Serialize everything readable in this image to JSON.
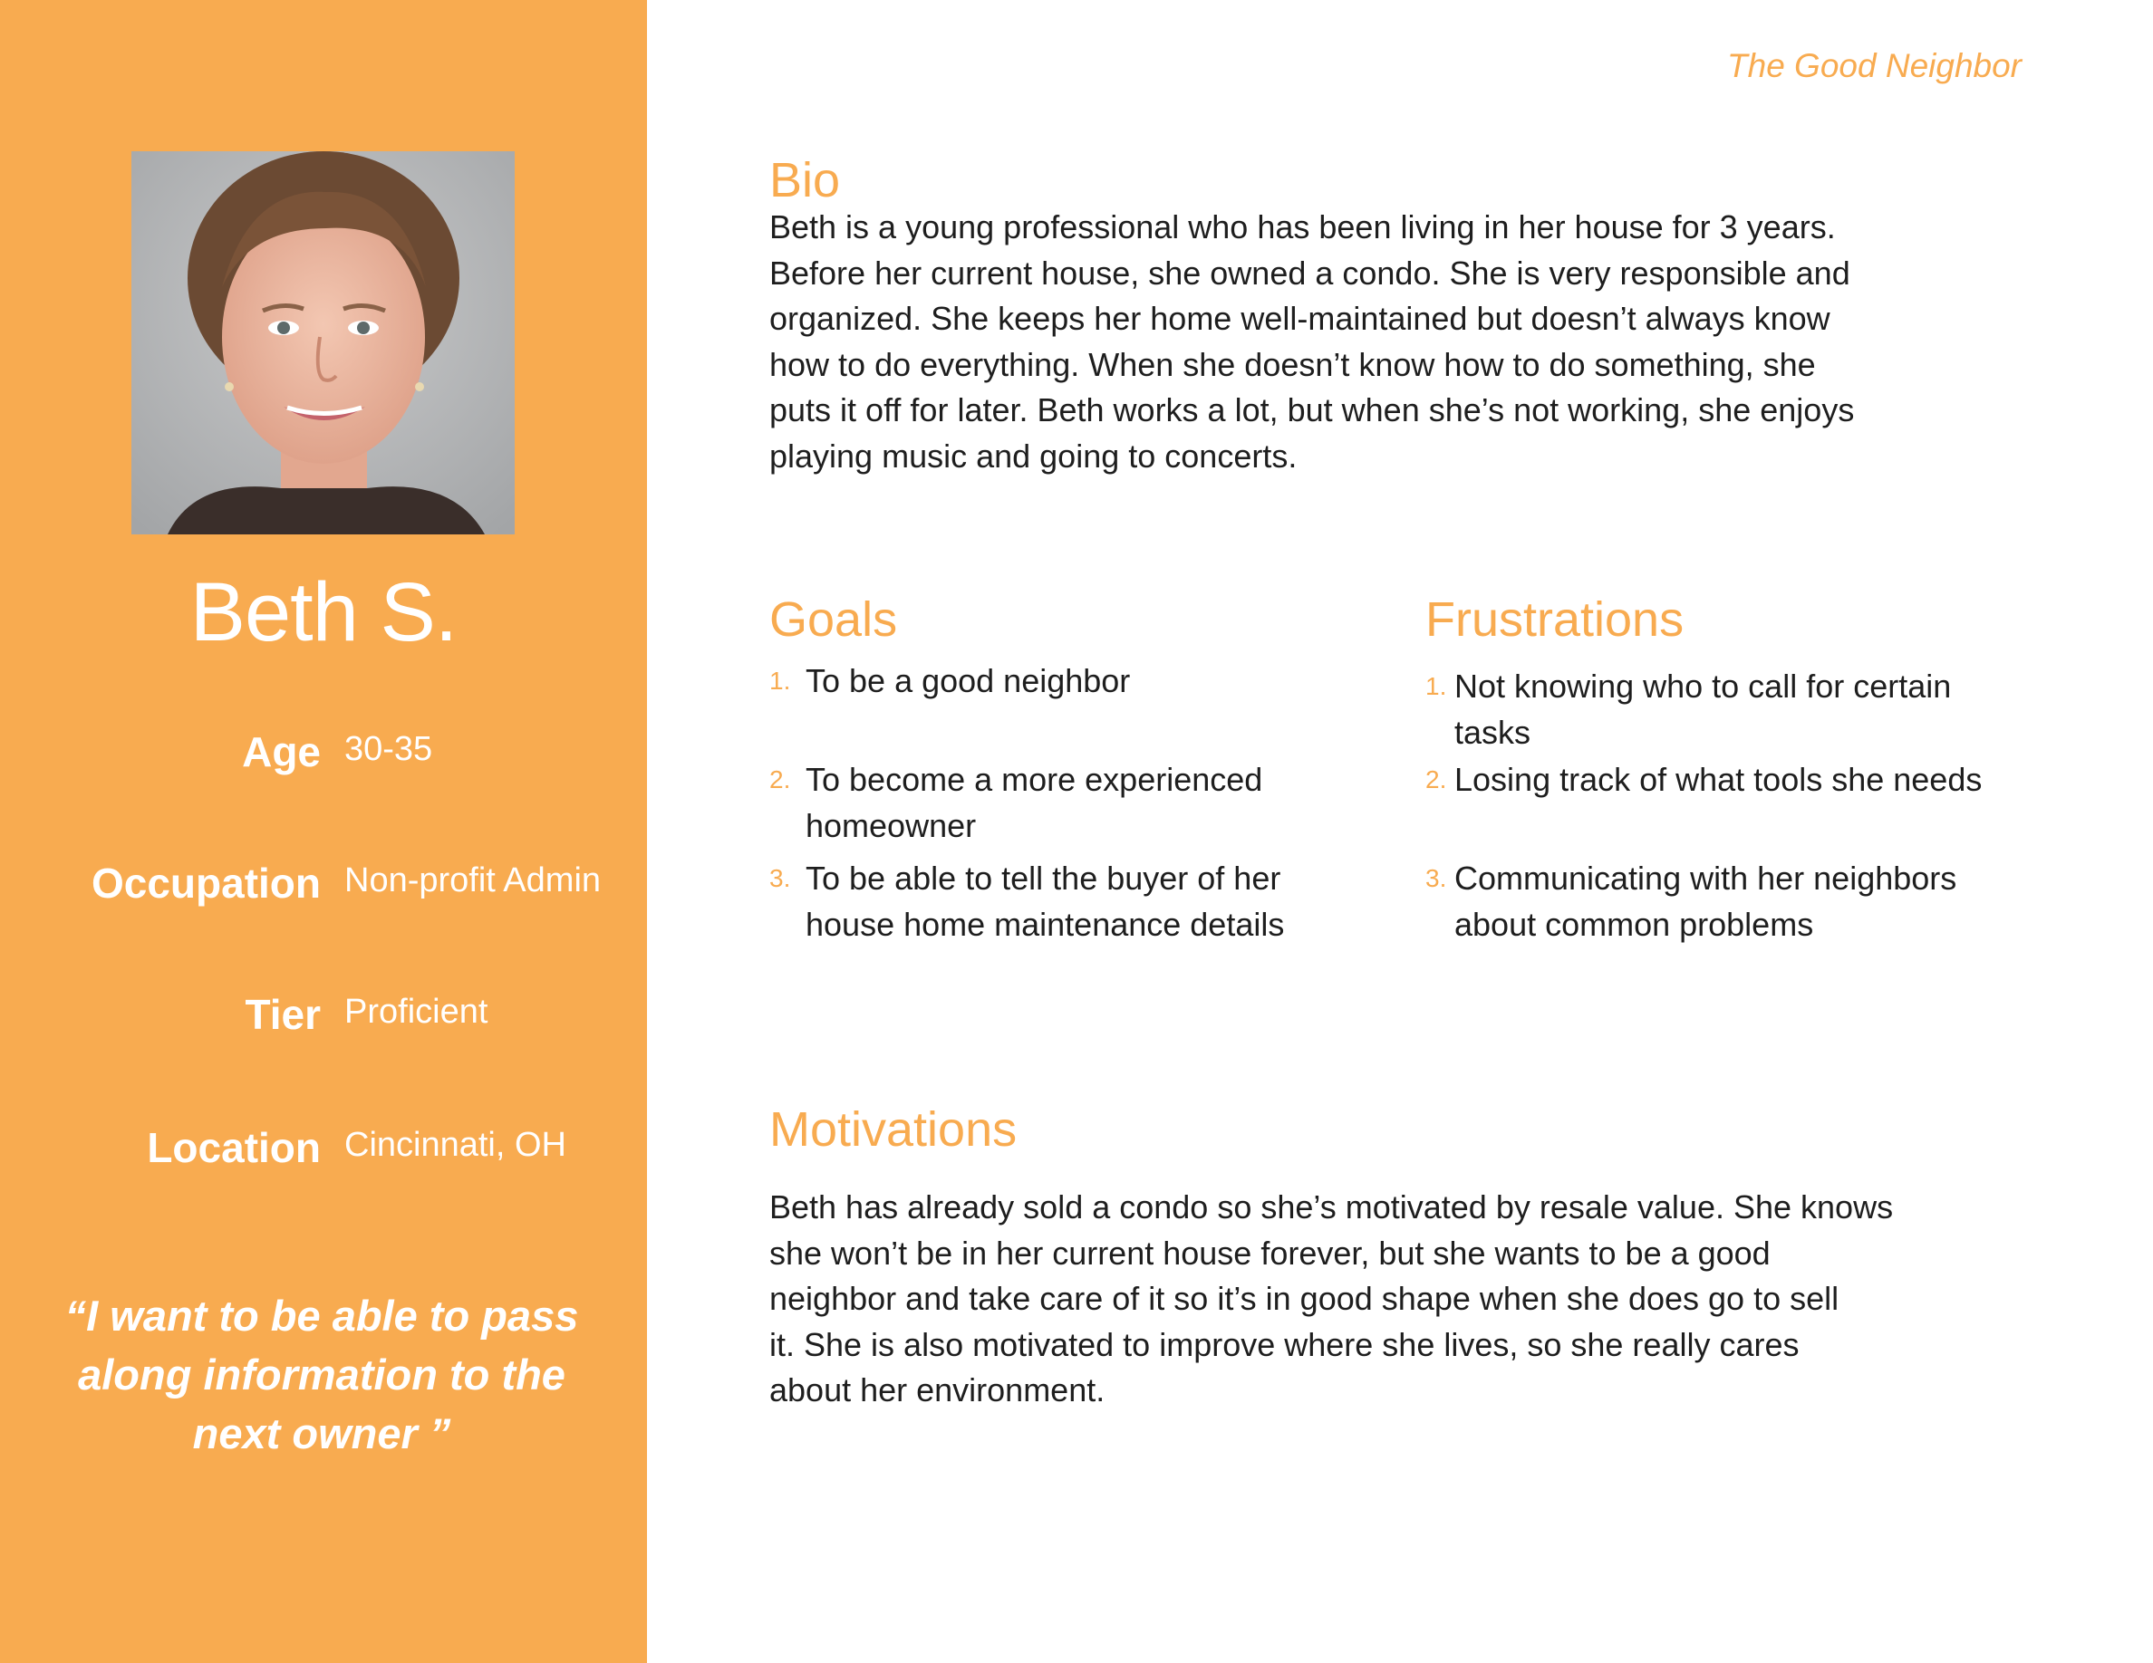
{
  "persona": {
    "type": "The Good Neighbor",
    "name": "Beth S.",
    "photo": "portrait-photo",
    "attributes": [
      {
        "label": "Age",
        "value": "30-35"
      },
      {
        "label": "Occupation",
        "value": "Non-profit Admin"
      },
      {
        "label": "Tier",
        "value": "Proficient"
      },
      {
        "label": "Location",
        "value": "Cincinnati, OH"
      }
    ],
    "quote": "“I want to be able to pass along information to the next owner ”"
  },
  "bio": {
    "heading": "Bio",
    "lines": [
      "Beth is a young professional who has been living in her house for 3 years.",
      "Before her current house, she owned a condo. She is very responsible and",
      "organized. She keeps her home well-maintained but doesn’t always know",
      "how to do everything. When she doesn’t know how to do something, she",
      "puts it off for later. Beth works a lot, but when she’s not working, she enjoys",
      "playing music and going to concerts."
    ]
  },
  "goals": {
    "heading": "Goals",
    "items": [
      {
        "num": "1.",
        "lines": [
          "To be a good neighbor"
        ]
      },
      {
        "num": "2.",
        "lines": [
          "To become a more experienced",
          "homeowner"
        ]
      },
      {
        "num": "3.",
        "lines": [
          "To be able to tell the buyer of her",
          "house home maintenance details"
        ]
      }
    ]
  },
  "frustrations": {
    "heading": "Frustrations",
    "items": [
      {
        "num": "1.",
        "lines": [
          "Not knowing who to call for certain",
          "tasks"
        ]
      },
      {
        "num": "2.",
        "lines": [
          "Losing track of what tools she needs"
        ]
      },
      {
        "num": "3.",
        "lines": [
          "Communicating with her neighbors",
          "about common problems"
        ]
      }
    ]
  },
  "motivations": {
    "heading": "Motivations",
    "lines": [
      "Beth has already sold a condo so she’s motivated by resale value. She knows",
      "she won’t be in her current house forever, but she wants to be a good",
      "neighbor and take care of it so it’s in good shape when she does go to sell",
      "it. She is also motivated to improve where she lives, so she really cares",
      "about her environment."
    ]
  },
  "colors": {
    "accent": "#f8ab50",
    "text": "#1e1e1e",
    "sidebar_text": "#ffffff"
  }
}
